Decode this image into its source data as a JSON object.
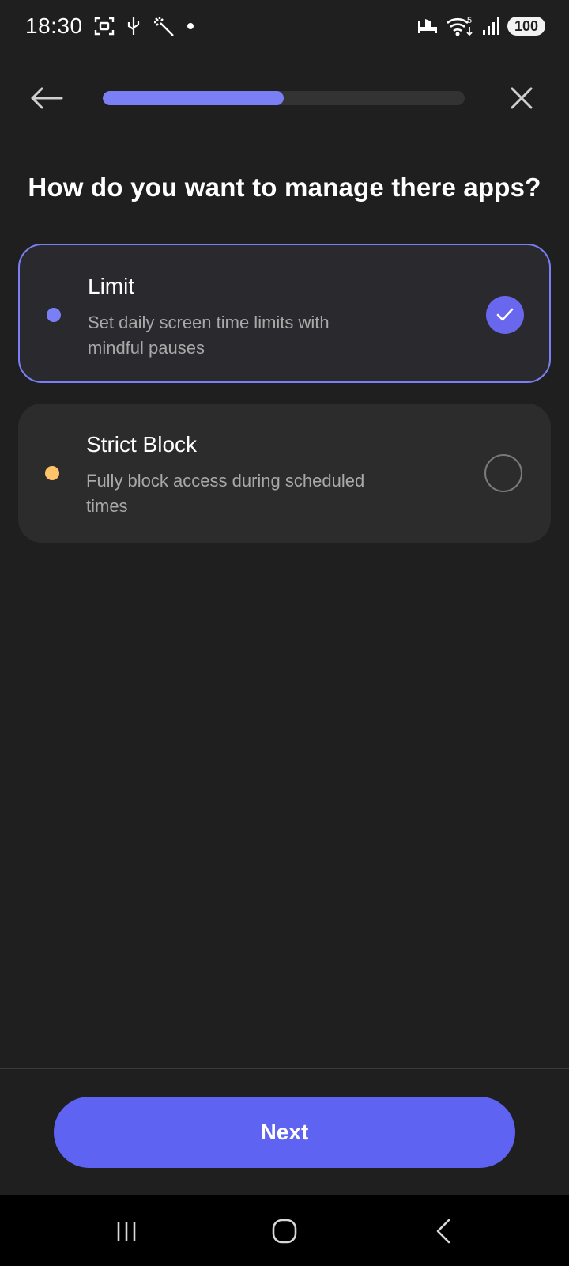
{
  "status_bar": {
    "time": "18:30",
    "battery": "100",
    "wifi_badge": "5",
    "icons": [
      "screenshot-icon",
      "usb-icon",
      "magic-wand-icon",
      "notification-dot-icon",
      "sleep-mode-icon",
      "wifi-icon",
      "signal-icon",
      "battery-icon"
    ]
  },
  "nav": {
    "progress": 0.5,
    "back_icon": "arrow-left-icon",
    "close_icon": "close-icon"
  },
  "question": "How do you want to manage there apps?",
  "options": [
    {
      "title": "Limit",
      "description": "Set daily screen time limits with mindful pauses",
      "dot_color": "#7b7ff5",
      "selected": true
    },
    {
      "title": "Strict Block",
      "description": "Fully block access during scheduled times",
      "dot_color": "#ffc46b",
      "selected": false
    }
  ],
  "next_label": "Next",
  "colors": {
    "accent": "#5f63f2",
    "background": "#1f1f1f",
    "card": "#2c2c2c"
  },
  "system_nav": [
    "recents-icon",
    "home-icon",
    "back-icon"
  ]
}
